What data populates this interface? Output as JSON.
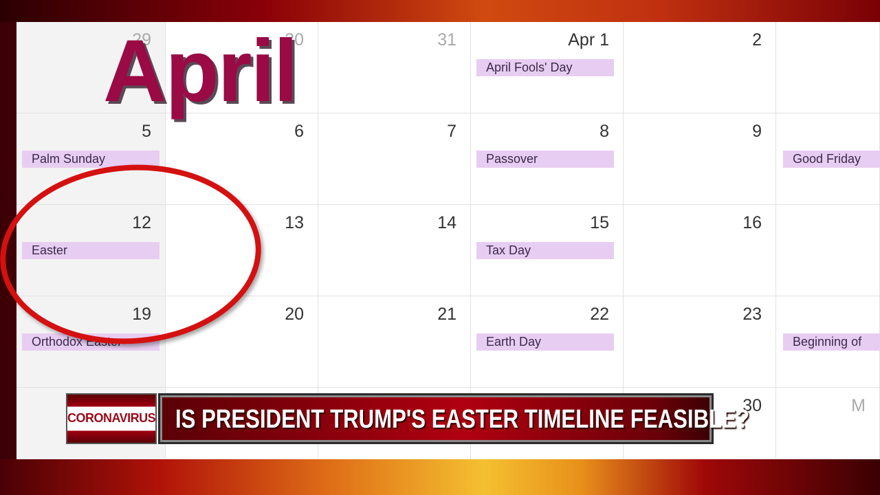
{
  "calendar": {
    "title": "April",
    "weeks": [
      [
        {
          "day": "29",
          "dim": true,
          "weekend": true,
          "event": ""
        },
        {
          "day": "30",
          "dim": true,
          "weekend": false,
          "event": ""
        },
        {
          "day": "31",
          "dim": true,
          "weekend": false,
          "event": ""
        },
        {
          "day": "Apr 1",
          "dim": false,
          "weekend": false,
          "event": "April Fools' Day"
        },
        {
          "day": "2",
          "dim": false,
          "weekend": false,
          "event": ""
        },
        {
          "day": "",
          "dim": false,
          "weekend": false,
          "event": ""
        }
      ],
      [
        {
          "day": "5",
          "dim": false,
          "weekend": true,
          "event": "Palm Sunday"
        },
        {
          "day": "6",
          "dim": false,
          "weekend": false,
          "event": ""
        },
        {
          "day": "7",
          "dim": false,
          "weekend": false,
          "event": ""
        },
        {
          "day": "8",
          "dim": false,
          "weekend": false,
          "event": "Passover"
        },
        {
          "day": "9",
          "dim": false,
          "weekend": false,
          "event": ""
        },
        {
          "day": "",
          "dim": false,
          "weekend": false,
          "event": "Good Friday"
        }
      ],
      [
        {
          "day": "12",
          "dim": false,
          "weekend": true,
          "event": "Easter"
        },
        {
          "day": "13",
          "dim": false,
          "weekend": false,
          "event": ""
        },
        {
          "day": "14",
          "dim": false,
          "weekend": false,
          "event": ""
        },
        {
          "day": "15",
          "dim": false,
          "weekend": false,
          "event": "Tax Day"
        },
        {
          "day": "16",
          "dim": false,
          "weekend": false,
          "event": ""
        },
        {
          "day": "",
          "dim": false,
          "weekend": false,
          "event": ""
        }
      ],
      [
        {
          "day": "19",
          "dim": false,
          "weekend": true,
          "event": "Orthodox Easter"
        },
        {
          "day": "20",
          "dim": false,
          "weekend": false,
          "event": ""
        },
        {
          "day": "21",
          "dim": false,
          "weekend": false,
          "event": ""
        },
        {
          "day": "22",
          "dim": false,
          "weekend": false,
          "event": "Earth Day"
        },
        {
          "day": "23",
          "dim": false,
          "weekend": false,
          "event": ""
        },
        {
          "day": "",
          "dim": false,
          "weekend": false,
          "event": "Beginning of"
        }
      ],
      [
        {
          "day": "",
          "dim": false,
          "weekend": true,
          "event": ""
        },
        {
          "day": "",
          "dim": false,
          "weekend": false,
          "event": ""
        },
        {
          "day": "",
          "dim": false,
          "weekend": false,
          "event": ""
        },
        {
          "day": "",
          "dim": false,
          "weekend": false,
          "event": ""
        },
        {
          "day": "30",
          "dim": false,
          "weekend": false,
          "event": ""
        },
        {
          "day": "M",
          "dim": true,
          "weekend": false,
          "event": ""
        }
      ]
    ]
  },
  "lower_third": {
    "tag": "CORONAVIRUS",
    "headline": "IS PRESIDENT TRUMP'S EASTER TIMELINE FEASIBLE?"
  }
}
